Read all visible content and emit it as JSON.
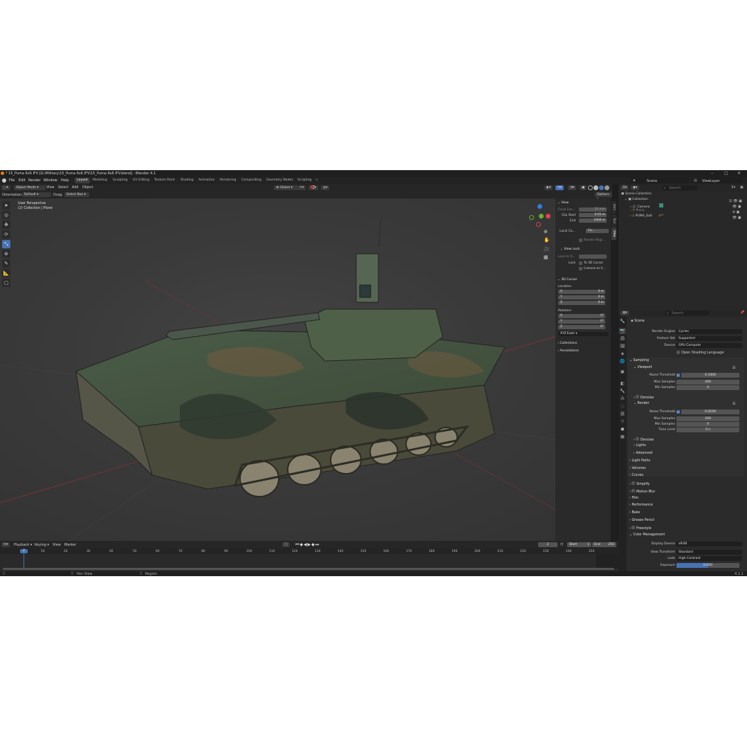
{
  "window": {
    "title": "* 15_Puma 6x6 IFV [G:\\Military\\15_Puma 6x6 IFV\\15_Puma 6x6 IFV.blend] - Blender 4.1"
  },
  "menu": [
    "File",
    "Edit",
    "Render",
    "Window",
    "Help"
  ],
  "workspaces": [
    "Layout",
    "Modeling",
    "Sculpting",
    "UV Editing",
    "Texture Paint",
    "Shading",
    "Animation",
    "Rendering",
    "Compositing",
    "Geometry Nodes",
    "Scripting",
    "+"
  ],
  "topright": {
    "scene": "Scene",
    "viewlayer": "ViewLayer"
  },
  "viewport_header": {
    "mode": "Object Mode",
    "menus": [
      "View",
      "Select",
      "Add",
      "Object"
    ],
    "transform": "Global",
    "orientation_label": "Orientation:",
    "orientation_value": "Default",
    "drag_label": "Drag:",
    "drag_value": "Select Box",
    "options": "Options"
  },
  "viewport": {
    "line1": "User Perspective",
    "line2": "(2) Collection | Plane"
  },
  "npanel": {
    "view_head": "View",
    "focal_label": "Focal Len...",
    "focal_value": "50 mm",
    "clip_start_label": "Clip Start",
    "clip_start_value": "0.01 m",
    "end_label": "End",
    "end_value": "1000 m",
    "local_cam_label": "Local Ca...",
    "local_cam_value": "Ca...",
    "render_region": "Render Regi...",
    "viewlock_head": "View Lock",
    "lock_to_label": "Lock to O...",
    "lock_label": "Lock",
    "to_cursor": "To 3D Cursor",
    "camera_to": "Camera to V...",
    "cursor_head": "3D Cursor",
    "location_label": "Location:",
    "rotation_label": "Rotation:",
    "loc": [
      {
        "axis": "X",
        "value": "0 m"
      },
      {
        "axis": "Y",
        "value": "0 m"
      },
      {
        "axis": "Z",
        "value": "0 m"
      }
    ],
    "rot": [
      {
        "axis": "X",
        "value": "0°"
      },
      {
        "axis": "Y",
        "value": "0°"
      },
      {
        "axis": "Z",
        "value": "0°"
      }
    ],
    "euler": "XYZ Euler",
    "collections": "Collections",
    "annotations": "Annotations",
    "tabs": [
      "Item",
      "Tool",
      "View"
    ]
  },
  "outliner": {
    "search_placeholder": "Search",
    "root": "Scene Collection",
    "collection": "Collection",
    "items": [
      "Camera",
      "Plane",
      "PUMA_6x6"
    ]
  },
  "properties": {
    "search_placeholder": "Search",
    "scene": "Scene",
    "render_engine_label": "Render Engine",
    "render_engine": "Cycles",
    "feature_set_label": "Feature Set",
    "feature_set": "Supported",
    "device_label": "Device",
    "device": "GPU Compute",
    "osl": "Open Shading Language",
    "sampling": "Sampling",
    "viewport": "Viewport",
    "noise_threshold_label": "Noise Threshold",
    "vp_noise": "0.1000",
    "max_samples_label": "Max Samples",
    "vp_max": "200",
    "min_samples_label": "Min Samples",
    "vp_min": "0",
    "denoise": "Denoise",
    "render": "Render",
    "r_noise": "0.0100",
    "r_max": "200",
    "r_min": "0",
    "time_limit_label": "Time Limit",
    "time_limit": "0 s",
    "lights": "Lights",
    "advanced": "Advanced",
    "sections": [
      "Light Paths",
      "Volumes",
      "Curves",
      "Simplify",
      "Motion Blur",
      "Film",
      "Performance",
      "Bake",
      "Grease Pencil",
      "Freestyle",
      "Color Management"
    ],
    "display_device_label": "Display Device",
    "display_device": "sRGB",
    "view_transform_label": "View Transform",
    "view_transform": "Standard",
    "look_label": "Look",
    "look": "High Contrast",
    "exposure_label": "Exposure",
    "exposure": "0.000"
  },
  "timeline": {
    "menus": [
      "Playback",
      "Keying",
      "View",
      "Marker"
    ],
    "current_frame": "2",
    "start_label": "Start",
    "start": "1",
    "end_label": "End",
    "end": "250",
    "ticks": [
      "2",
      "10",
      "20",
      "30",
      "40",
      "50",
      "60",
      "70",
      "80",
      "90",
      "100",
      "110",
      "120",
      "130",
      "140",
      "150",
      "160",
      "170",
      "180",
      "190",
      "200",
      "210",
      "220",
      "230",
      "240",
      "250"
    ]
  },
  "status": {
    "pan": "Pan View",
    "region": "Region",
    "version": "4.1.1"
  },
  "colors": {
    "accent": "#4772b3",
    "bg": "#1d1d1d",
    "panel": "#2b2b2b"
  }
}
